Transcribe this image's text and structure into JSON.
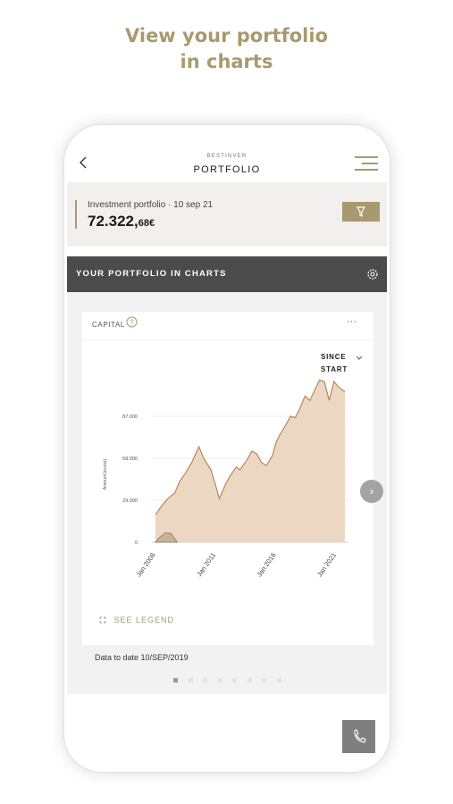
{
  "headline": {
    "line1": "View your portfolio",
    "line2": "in charts"
  },
  "header": {
    "brand": "BESTINVER",
    "title": "PORTFOLIO"
  },
  "investment": {
    "label": "Investment portfolio · 10 sep 21",
    "value_main": "72.322,",
    "value_cents": "68€"
  },
  "charts_section": {
    "title": "YOUR PORTFOLIO IN CHARTS"
  },
  "chart_card": {
    "title": "CAPITAL",
    "more": "···",
    "range_line1": "SINCE",
    "range_line2": "START",
    "legend_label": "SEE LEGEND",
    "footer": "Data to date 10/SEP/2019",
    "next_icon": "›"
  },
  "pagination": {
    "count": 8,
    "active_index": 0
  },
  "colors": {
    "accent": "#a89a6e",
    "area_fill": "#ecd7c3",
    "line": "#b8865a",
    "dark_bar": "#4b4b4b"
  },
  "chart_data": {
    "type": "area",
    "title": "CAPITAL",
    "ylabel": "Amount (euros)",
    "yticks": [
      0,
      29000,
      58000,
      87000
    ],
    "ytick_labels": [
      "0",
      "29.000",
      "58.000",
      "87.000"
    ],
    "xtick_labels": [
      "Jan 2006",
      "Jan 2011",
      "Jan 2016",
      "Jan 2021"
    ],
    "xlim": [
      2006,
      2022
    ],
    "ylim": [
      0,
      116000
    ],
    "series": [
      {
        "x": [
          2006.0,
          2006.5,
          2007.0,
          2007.6,
          2008.0,
          2008.5,
          2009.0,
          2009.6,
          2010.0,
          2010.6,
          2011.0,
          2011.3,
          2011.8,
          2012.2,
          2012.7,
          2013.0,
          2013.6,
          2014.0,
          2014.4,
          2014.8,
          2015.2,
          2015.7,
          2016.0,
          2016.3,
          2016.8,
          2017.2,
          2017.6,
          2018.0,
          2018.4,
          2018.8,
          2019.2,
          2019.6,
          2020.0,
          2020.4,
          2020.8,
          2021.2,
          2021.7
        ],
        "y": [
          19000,
          25000,
          30000,
          34000,
          42000,
          48000,
          55000,
          66000,
          58000,
          50000,
          39000,
          30000,
          40000,
          46000,
          52000,
          50000,
          57000,
          63000,
          61000,
          55000,
          53000,
          60000,
          69000,
          74000,
          81000,
          87000,
          86000,
          93000,
          101000,
          98000,
          105000,
          112000,
          111000,
          98000,
          111000,
          107000,
          104000
        ]
      },
      {
        "x": [
          2006.0,
          2006.3,
          2006.8,
          2007.3,
          2007.8
        ],
        "y": [
          0,
          3000,
          6500,
          6000,
          0
        ]
      }
    ]
  }
}
